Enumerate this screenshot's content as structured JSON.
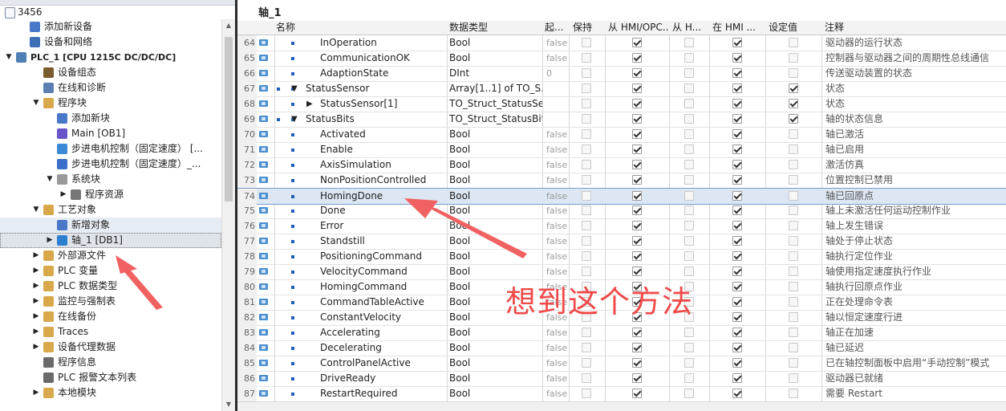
{
  "project": "3456",
  "tree": [
    {
      "label": "添加新设备",
      "indent": 1,
      "toggle": "",
      "icon": "add-device-icon",
      "color": "#4a78c8"
    },
    {
      "label": "设备和网络",
      "indent": 1,
      "toggle": "",
      "icon": "network-icon",
      "color": "#3c6fb6"
    },
    {
      "label": "PLC_1 [CPU 1215C DC/DC/DC]",
      "indent": 0,
      "toggle": "▼",
      "icon": "plc-icon",
      "color": "#4f7fb4",
      "bold": true
    },
    {
      "label": "设备组态",
      "indent": 2,
      "toggle": "",
      "icon": "device-config-icon",
      "color": "#7a5c2e"
    },
    {
      "label": "在线和诊断",
      "indent": 2,
      "toggle": "",
      "icon": "diagnostics-icon",
      "color": "#5a7fb0"
    },
    {
      "label": "程序块",
      "indent": 2,
      "toggle": "▼",
      "icon": "folder-icon",
      "color": "#d8a84a"
    },
    {
      "label": "添加新块",
      "indent": 3,
      "toggle": "",
      "icon": "add-block-icon",
      "color": "#4a78c8"
    },
    {
      "label": "Main [OB1]",
      "indent": 3,
      "toggle": "",
      "icon": "ob-icon",
      "color": "#6a55c8"
    },
    {
      "label": "步进电机控制（固定速度） [...",
      "indent": 3,
      "toggle": "",
      "icon": "fb-icon",
      "color": "#3c8ad6"
    },
    {
      "label": "步进电机控制（固定速度）_...",
      "indent": 3,
      "toggle": "",
      "icon": "db-icon",
      "color": "#3a6ec8"
    },
    {
      "label": "系统块",
      "indent": 3,
      "toggle": "▼",
      "icon": "system-block-icon",
      "color": "#999999"
    },
    {
      "label": "程序资源",
      "indent": 4,
      "toggle": "▶",
      "icon": "program-resource-icon",
      "color": "#777777"
    },
    {
      "label": "工艺对象",
      "indent": 2,
      "toggle": "▼",
      "icon": "folder-icon",
      "color": "#d8a84a"
    },
    {
      "label": "新增对象",
      "indent": 3,
      "toggle": "",
      "icon": "add-object-icon",
      "color": "#4a78c8",
      "hover": true
    },
    {
      "label": "轴_1 [DB1]",
      "indent": 3,
      "toggle": "▶",
      "icon": "axis-icon",
      "color": "#2d7fd0",
      "selected": true
    },
    {
      "label": "外部源文件",
      "indent": 2,
      "toggle": "▶",
      "icon": "folder-icon",
      "color": "#d8a84a"
    },
    {
      "label": "PLC 变量",
      "indent": 2,
      "toggle": "▶",
      "icon": "tags-icon",
      "color": "#d8a84a"
    },
    {
      "label": "PLC 数据类型",
      "indent": 2,
      "toggle": "▶",
      "icon": "datatype-icon",
      "color": "#d8a84a"
    },
    {
      "label": "监控与强制表",
      "indent": 2,
      "toggle": "▶",
      "icon": "watch-table-icon",
      "color": "#d8a84a"
    },
    {
      "label": "在线备份",
      "indent": 2,
      "toggle": "▶",
      "icon": "backup-icon",
      "color": "#d8a84a"
    },
    {
      "label": "Traces",
      "indent": 2,
      "toggle": "▶",
      "icon": "traces-icon",
      "color": "#d8a84a"
    },
    {
      "label": "设备代理数据",
      "indent": 2,
      "toggle": "▶",
      "icon": "proxy-data-icon",
      "color": "#d8a84a"
    },
    {
      "label": "程序信息",
      "indent": 2,
      "toggle": "",
      "icon": "program-info-icon",
      "color": "#6a6a6a"
    },
    {
      "label": "PLC 报警文本列表",
      "indent": 2,
      "toggle": "",
      "icon": "alarm-text-icon",
      "color": "#6a6a6a"
    },
    {
      "label": "本地模块",
      "indent": 2,
      "toggle": "▶",
      "icon": "folder-icon",
      "color": "#d8a84a"
    }
  ],
  "editor": {
    "title": "轴_1",
    "headers": [
      "名称",
      "数据类型",
      "起...",
      "保持",
      "从 HMI/OPC...",
      "从 H...",
      "在 HMI ...",
      "设定值",
      "注释"
    ]
  },
  "rows": [
    {
      "num": "64",
      "level": 2,
      "toggle": "",
      "name": "InOperation",
      "type": "Bool",
      "start": "false",
      "c": [
        0,
        1,
        0,
        1,
        0
      ],
      "comment": "驱动器的运行状态"
    },
    {
      "num": "65",
      "level": 2,
      "toggle": "",
      "name": "CommunicationOK",
      "type": "Bool",
      "start": "false",
      "c": [
        0,
        1,
        0,
        1,
        0
      ],
      "comment": "控制器与驱动器之间的周期性总线通信"
    },
    {
      "num": "66",
      "level": 2,
      "toggle": "",
      "name": "AdaptionState",
      "type": "DInt",
      "start": "0",
      "c": [
        0,
        1,
        0,
        1,
        0
      ],
      "comment": "传送驱动装置的状态"
    },
    {
      "num": "67",
      "level": 0,
      "toggle": "▼",
      "name": "StatusSensor",
      "type": "Array[1..1] of TO_S...",
      "start": "",
      "c": [
        0,
        1,
        0,
        1,
        1
      ],
      "comment": "状态"
    },
    {
      "num": "68",
      "level": 1,
      "toggle": "▶",
      "name": "StatusSensor[1]",
      "type": "TO_Struct_StatusSe...",
      "start": "",
      "c": [
        0,
        1,
        0,
        1,
        1
      ],
      "comment": "状态"
    },
    {
      "num": "69",
      "level": 0,
      "toggle": "▼",
      "name": "StatusBits",
      "type": "TO_Struct_StatusBits",
      "start": "",
      "c": [
        0,
        1,
        0,
        1,
        1
      ],
      "comment": "轴的状态信息"
    },
    {
      "num": "70",
      "level": 2,
      "toggle": "",
      "name": "Activated",
      "type": "Bool",
      "start": "false",
      "c": [
        0,
        1,
        0,
        1,
        0
      ],
      "comment": "轴已激活"
    },
    {
      "num": "71",
      "level": 2,
      "toggle": "",
      "name": "Enable",
      "type": "Bool",
      "start": "false",
      "c": [
        0,
        1,
        0,
        1,
        0
      ],
      "comment": "轴已启用"
    },
    {
      "num": "72",
      "level": 2,
      "toggle": "",
      "name": "AxisSimulation",
      "type": "Bool",
      "start": "false",
      "c": [
        0,
        1,
        0,
        1,
        0
      ],
      "comment": "激活仿真"
    },
    {
      "num": "73",
      "level": 2,
      "toggle": "",
      "name": "NonPositionControlled",
      "type": "Bool",
      "start": "false",
      "c": [
        0,
        1,
        0,
        1,
        0
      ],
      "comment": "位置控制已禁用"
    },
    {
      "num": "74",
      "level": 2,
      "toggle": "",
      "name": "HomingDone",
      "type": "Bool",
      "start": "false",
      "c": [
        0,
        1,
        0,
        1,
        0
      ],
      "comment": "轴已回原点",
      "selected": true
    },
    {
      "num": "75",
      "level": 2,
      "toggle": "",
      "name": "Done",
      "type": "Bool",
      "start": "false",
      "c": [
        0,
        1,
        0,
        1,
        0
      ],
      "comment": "轴上未激活任何运动控制作业"
    },
    {
      "num": "76",
      "level": 2,
      "toggle": "",
      "name": "Error",
      "type": "Bool",
      "start": "false",
      "c": [
        0,
        1,
        0,
        1,
        0
      ],
      "comment": "轴上发生错误"
    },
    {
      "num": "77",
      "level": 2,
      "toggle": "",
      "name": "Standstill",
      "type": "Bool",
      "start": "false",
      "c": [
        0,
        1,
        0,
        1,
        0
      ],
      "comment": "轴处于停止状态"
    },
    {
      "num": "78",
      "level": 2,
      "toggle": "",
      "name": "PositioningCommand",
      "type": "Bool",
      "start": "false",
      "c": [
        0,
        1,
        0,
        1,
        0
      ],
      "comment": "轴执行定位作业"
    },
    {
      "num": "79",
      "level": 2,
      "toggle": "",
      "name": "VelocityCommand",
      "type": "Bool",
      "start": "false",
      "c": [
        0,
        1,
        0,
        1,
        0
      ],
      "comment": "轴使用指定速度执行作业"
    },
    {
      "num": "80",
      "level": 2,
      "toggle": "",
      "name": "HomingCommand",
      "type": "Bool",
      "start": "false",
      "c": [
        0,
        1,
        0,
        1,
        0
      ],
      "comment": "轴执行回原点作业"
    },
    {
      "num": "81",
      "level": 2,
      "toggle": "",
      "name": "CommandTableActive",
      "type": "Bool",
      "start": "false",
      "c": [
        0,
        1,
        0,
        1,
        0
      ],
      "comment": "正在处理命令表"
    },
    {
      "num": "82",
      "level": 2,
      "toggle": "",
      "name": "ConstantVelocity",
      "type": "Bool",
      "start": "false",
      "c": [
        0,
        1,
        0,
        1,
        0
      ],
      "comment": "轴以恒定速度行进"
    },
    {
      "num": "83",
      "level": 2,
      "toggle": "",
      "name": "Accelerating",
      "type": "Bool",
      "start": "false",
      "c": [
        0,
        1,
        0,
        1,
        0
      ],
      "comment": "轴正在加速"
    },
    {
      "num": "84",
      "level": 2,
      "toggle": "",
      "name": "Decelerating",
      "type": "Bool",
      "start": "false",
      "c": [
        0,
        1,
        0,
        1,
        0
      ],
      "comment": "轴已延迟"
    },
    {
      "num": "85",
      "level": 2,
      "toggle": "",
      "name": "ControlPanelActive",
      "type": "Bool",
      "start": "false",
      "c": [
        0,
        1,
        0,
        1,
        0
      ],
      "comment": "已在轴控制面板中启用“手动控制”模式"
    },
    {
      "num": "86",
      "level": 2,
      "toggle": "",
      "name": "DriveReady",
      "type": "Bool",
      "start": "false",
      "c": [
        0,
        1,
        0,
        1,
        0
      ],
      "comment": "驱动器已就绪"
    },
    {
      "num": "87",
      "level": 2,
      "toggle": "",
      "name": "RestartRequired",
      "type": "Bool",
      "start": "false",
      "c": [
        0,
        1,
        0,
        1,
        0
      ],
      "comment": "需要 Restart"
    }
  ],
  "annotation": {
    "text": "想到这个方法",
    "color": "#f04a4a"
  }
}
